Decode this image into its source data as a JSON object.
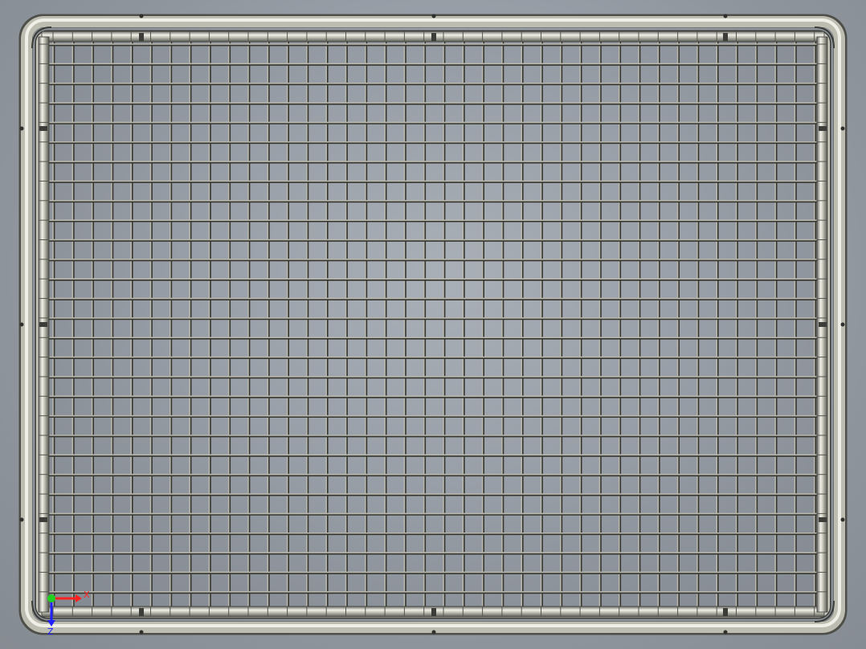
{
  "viewport": {
    "background": "#9ba2ab"
  },
  "part": {
    "frame_color": "#bdbdb0",
    "frame_highlight": "#ecebe3",
    "frame_shadow": "#5a5b55",
    "wire_color": "#b8b7ad",
    "wire_shadow": "#34352f"
  },
  "triad": {
    "x_label": "X",
    "z_label": "Z",
    "x_color": "#ff2020",
    "y_color": "#20d020",
    "z_color": "#2020ff"
  }
}
